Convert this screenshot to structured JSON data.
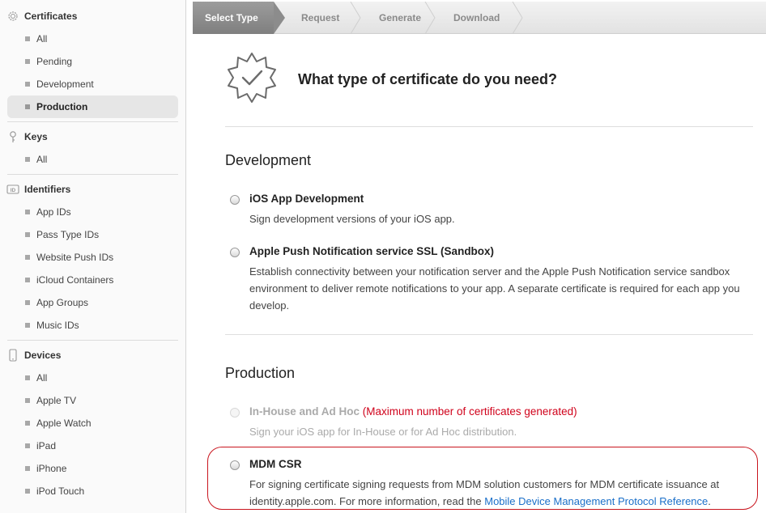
{
  "sidebar": {
    "sections": [
      {
        "title": "Certificates",
        "icon": "gear-badge-icon",
        "items": [
          "All",
          "Pending",
          "Development",
          "Production"
        ],
        "active": "Production"
      },
      {
        "title": "Keys",
        "icon": "key-icon",
        "items": [
          "All"
        ]
      },
      {
        "title": "Identifiers",
        "icon": "id-badge-icon",
        "items": [
          "App IDs",
          "Pass Type IDs",
          "Website Push IDs",
          "iCloud Containers",
          "App Groups",
          "Music IDs"
        ]
      },
      {
        "title": "Devices",
        "icon": "device-icon",
        "items": [
          "All",
          "Apple TV",
          "Apple Watch",
          "iPad",
          "iPhone",
          "iPod Touch"
        ]
      }
    ]
  },
  "steps": [
    "Select Type",
    "Request",
    "Generate",
    "Download"
  ],
  "main": {
    "title": "What type of certificate do you need?",
    "development": {
      "heading": "Development",
      "options": [
        {
          "title": "iOS App Development",
          "desc": "Sign development versions of your iOS app."
        },
        {
          "title": "Apple Push Notification service SSL (Sandbox)",
          "desc": "Establish connectivity between your notification server and the Apple Push Notification service sandbox environment to deliver remote notifications to your app. A separate certificate is required for each app you develop."
        }
      ]
    },
    "production": {
      "heading": "Production",
      "inhouse": {
        "title": "In-House and Ad Hoc",
        "warning": "(Maximum number of certificates generated)",
        "desc": "Sign your iOS app for In-House or for Ad Hoc distribution."
      },
      "mdm": {
        "title": "MDM CSR",
        "desc_prefix": "For signing certificate signing requests from MDM solution customers for MDM certificate issuance at identity.apple.com. For more information, read the ",
        "link": "Mobile Device Management Protocol Reference",
        "desc_suffix": "."
      }
    }
  },
  "colors": {
    "warning": "#d0021b",
    "link": "#1a6fc9",
    "highlight": "#c9151e"
  }
}
